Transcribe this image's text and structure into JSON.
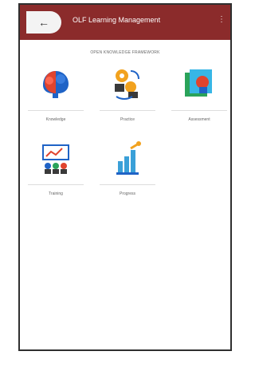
{
  "header": {
    "back_icon": "back-arrow-icon",
    "title": "OLF Learning Management",
    "right_icon": "menu-icon"
  },
  "screen": {
    "subtitle": "OPEN KNOWLEDGE FRAMEWORK"
  },
  "tiles": [
    {
      "label": "Knowledge",
      "icon": "brain-icon"
    },
    {
      "label": "Practice",
      "icon": "practice-icon"
    },
    {
      "label": "Assessment",
      "icon": "assessment-icon"
    },
    {
      "label": "Training",
      "icon": "training-icon"
    },
    {
      "label": "Progress",
      "icon": "progress-icon"
    }
  ],
  "colors": {
    "header_bg": "#8b2b2b",
    "back_btn_bg": "#f3f3f3"
  }
}
